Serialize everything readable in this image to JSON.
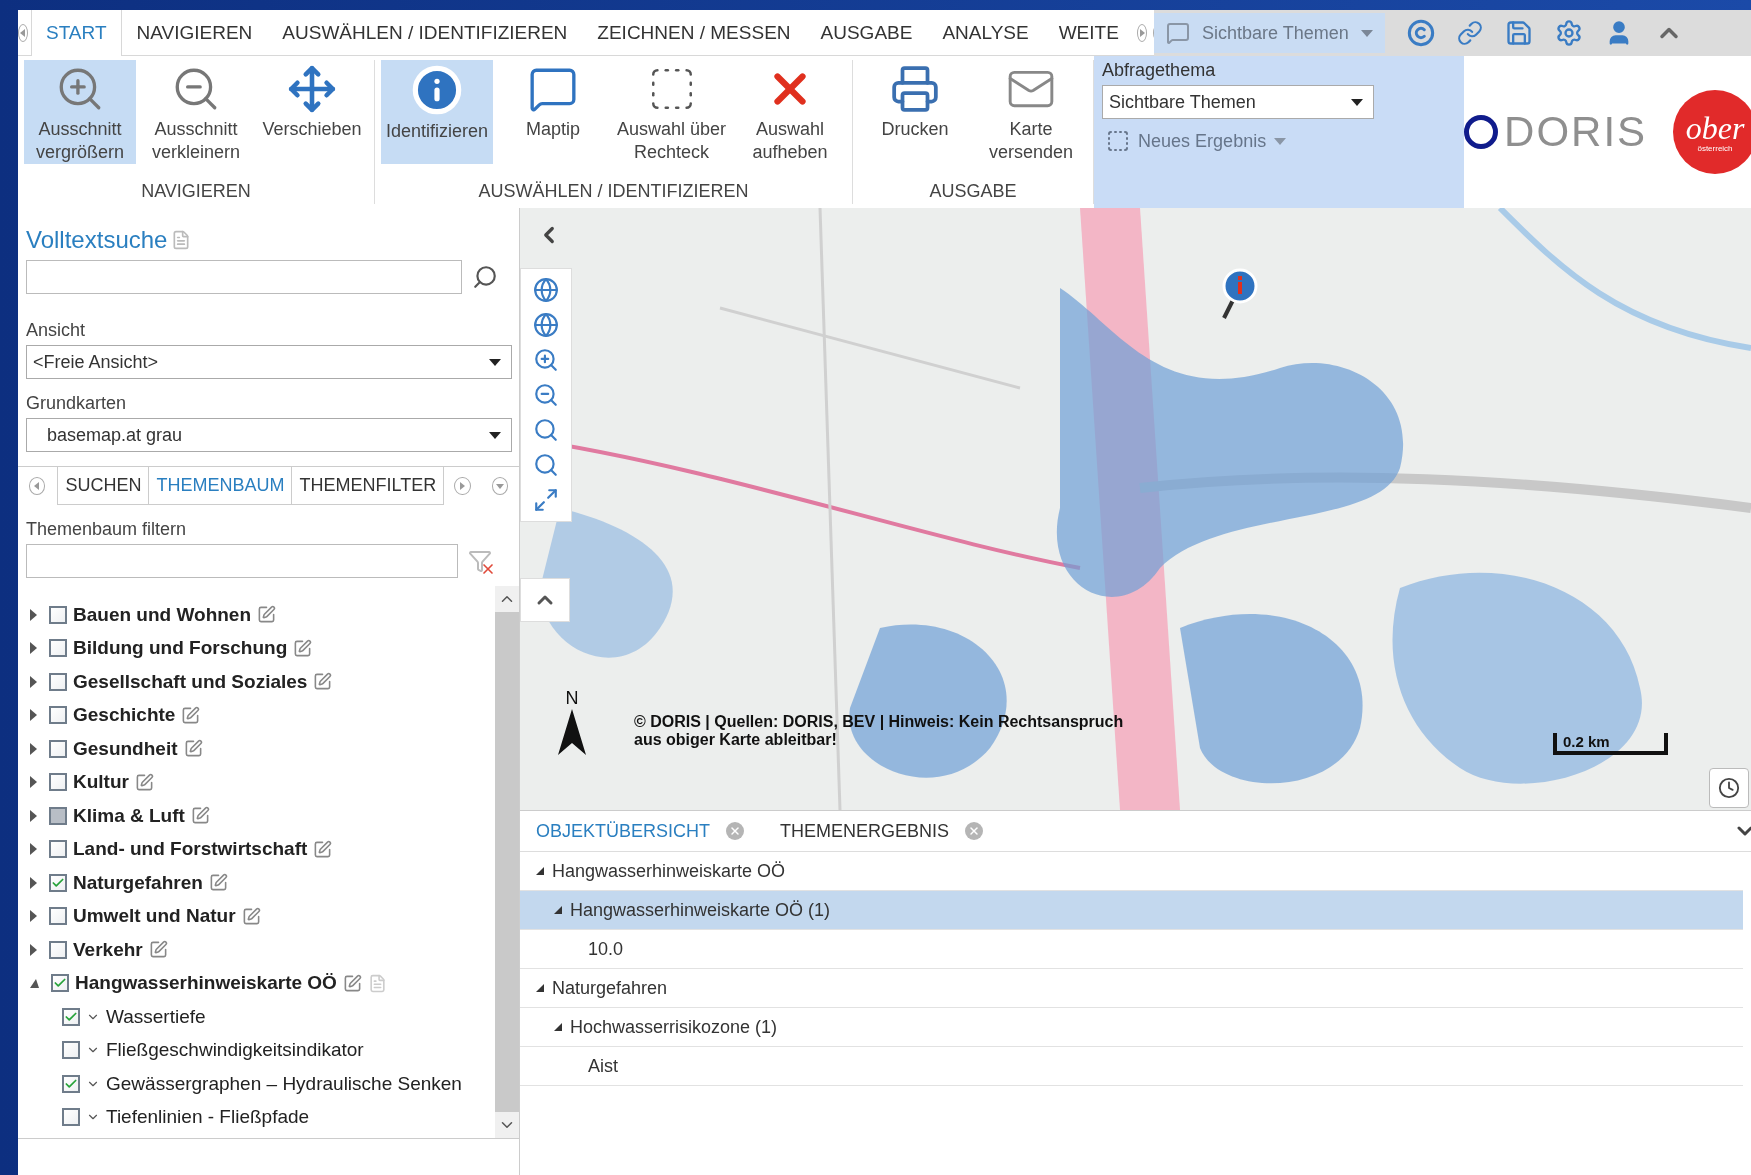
{
  "ribbon_tabs": [
    {
      "label": "START",
      "selected": true
    },
    {
      "label": "NAVIGIEREN",
      "selected": false
    },
    {
      "label": "AUSWÄHLEN / IDENTIFIZIEREN",
      "selected": false
    },
    {
      "label": "ZEICHNEN / MESSEN",
      "selected": false
    },
    {
      "label": "AUSGABE",
      "selected": false
    },
    {
      "label": "ANALYSE",
      "selected": false
    },
    {
      "label": "WEITE",
      "selected": false
    }
  ],
  "toolbar": {
    "theme_dropdown": "Sichtbare Themen"
  },
  "ribbon_groups": [
    {
      "title": "NAVIGIEREN",
      "items": [
        {
          "label": "Ausschnitt\nvergrößern",
          "selected": true
        },
        {
          "label": "Ausschnitt\nverkleinern",
          "selected": false
        },
        {
          "label": "Verschieben",
          "selected": false
        }
      ]
    },
    {
      "title": "AUSWÄHLEN / IDENTIFIZIEREN",
      "items": [
        {
          "label": "Identifizieren",
          "selected": true
        },
        {
          "label": "Maptip",
          "selected": false
        },
        {
          "label": "Auswahl über\nRechteck",
          "selected": false
        },
        {
          "label": "Auswahl\naufheben",
          "selected": false
        }
      ]
    },
    {
      "title": "AUSGABE",
      "items": [
        {
          "label": "Drucken",
          "selected": false
        },
        {
          "label": "Karte\nversenden",
          "selected": false
        }
      ]
    }
  ],
  "query_panel": {
    "label": "Abfragethema",
    "value": "Sichtbare Themen",
    "new_result": {
      "label": "Neues Ergebnis",
      "disabled": true
    }
  },
  "logos": {
    "brand": "DORIS",
    "region": "ober",
    "region_sub": "österreich"
  },
  "search_title": "Volltextsuche",
  "view": {
    "label": "Ansicht",
    "value": "<Freie Ansicht>"
  },
  "basemap": {
    "label": "Grundkarten",
    "value": "basemap.at grau"
  },
  "panel_tabs": [
    {
      "label": "SUCHEN",
      "selected": false
    },
    {
      "label": "THEMENBAUM",
      "selected": true
    },
    {
      "label": "THEMENFILTER",
      "selected": false
    }
  ],
  "tree_filter_label": "Themenbaum filtern",
  "theme_tree": [
    {
      "label": "Bauen und Wohnen",
      "checked": false,
      "partial": false,
      "expanded": false,
      "info_doc": false
    },
    {
      "label": "Bildung und Forschung",
      "checked": false,
      "partial": false,
      "expanded": false,
      "info_doc": false
    },
    {
      "label": "Gesellschaft und Soziales",
      "checked": false,
      "partial": false,
      "expanded": false,
      "info_doc": false
    },
    {
      "label": "Geschichte",
      "checked": false,
      "partial": false,
      "expanded": false,
      "info_doc": false
    },
    {
      "label": "Gesundheit",
      "checked": false,
      "partial": false,
      "expanded": false,
      "info_doc": false
    },
    {
      "label": "Kultur",
      "checked": false,
      "partial": false,
      "expanded": false,
      "info_doc": false
    },
    {
      "label": "Klima & Luft",
      "checked": false,
      "partial": true,
      "expanded": false,
      "info_doc": false
    },
    {
      "label": "Land- und Forstwirtschaft",
      "checked": false,
      "partial": false,
      "expanded": false,
      "info_doc": false
    },
    {
      "label": "Naturgefahren",
      "checked": true,
      "partial": false,
      "expanded": false,
      "info_doc": false
    },
    {
      "label": "Umwelt und Natur",
      "checked": false,
      "partial": false,
      "expanded": false,
      "info_doc": false
    },
    {
      "label": "Verkehr",
      "checked": false,
      "partial": false,
      "expanded": false,
      "info_doc": false
    },
    {
      "label": "Hangwasserhinweiskarte OÖ",
      "checked": true,
      "partial": false,
      "expanded": true,
      "info_doc": true,
      "children": [
        {
          "label": "Wassertiefe",
          "checked": true
        },
        {
          "label": "Fließgeschwindigkeitsindikator",
          "checked": false
        },
        {
          "label": "Gewässergraphen – Hydraulische Senken",
          "checked": true
        },
        {
          "label": "Tiefenlinien - Fließpfade",
          "checked": false
        }
      ]
    }
  ],
  "map": {
    "north": "N",
    "attribution": "© DORIS | Quellen: DORIS, BEV | Hinweis: Kein Rechtsanspruch\naus obiger Karte ableitbar!",
    "scale": "0.2 km"
  },
  "result_tabs": [
    {
      "label": "OBJEKTÜBERSICHT",
      "selected": true
    },
    {
      "label": "THEMENERGEBNIS",
      "selected": false
    }
  ],
  "results": [
    {
      "label": "Hangwasserhinweiskarte OÖ",
      "selected": false,
      "children": [
        {
          "label": "Hangwasserhinweiskarte OÖ (1)",
          "selected": true,
          "children": [
            {
              "label": "10.0",
              "selected": false
            }
          ]
        }
      ]
    },
    {
      "label": "Naturgefahren",
      "selected": false,
      "children": [
        {
          "label": "Hochwasserrisikozone (1)",
          "selected": false,
          "children": [
            {
              "label": "Aist",
              "selected": false
            }
          ]
        }
      ]
    }
  ]
}
